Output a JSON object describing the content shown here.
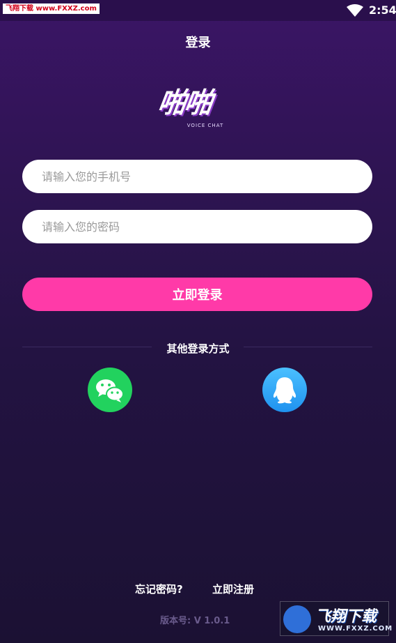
{
  "status_bar": {
    "source_badge": "飞翔下载 www.FXXZ.com",
    "time": "2:54",
    "wifi_icon": "wifi-icon"
  },
  "header": {
    "title": "登录"
  },
  "logo": {
    "text": "啪啪",
    "subtitle": "VOICE CHAT"
  },
  "form": {
    "phone_placeholder": "请输入您的手机号",
    "password_placeholder": "请输入您的密码",
    "login_label": "立即登录"
  },
  "social": {
    "label": "其他登录方式",
    "options": [
      {
        "name": "wechat",
        "icon": "wechat-icon",
        "color": "#22d25e"
      },
      {
        "name": "qq",
        "icon": "qq-penguin-icon",
        "color": "#2a9cf3"
      }
    ]
  },
  "footer": {
    "forgot_password": "忘记密码?",
    "register": "立即注册",
    "version": "版本号: V 1.0.1"
  },
  "watermark": {
    "brand": "飞翔下载",
    "url": "WWW.FXXZ.COM"
  },
  "colors": {
    "accent_pink": "#ff3aa8",
    "background_top": "#3b1566",
    "background_bottom": "#1b1133"
  }
}
